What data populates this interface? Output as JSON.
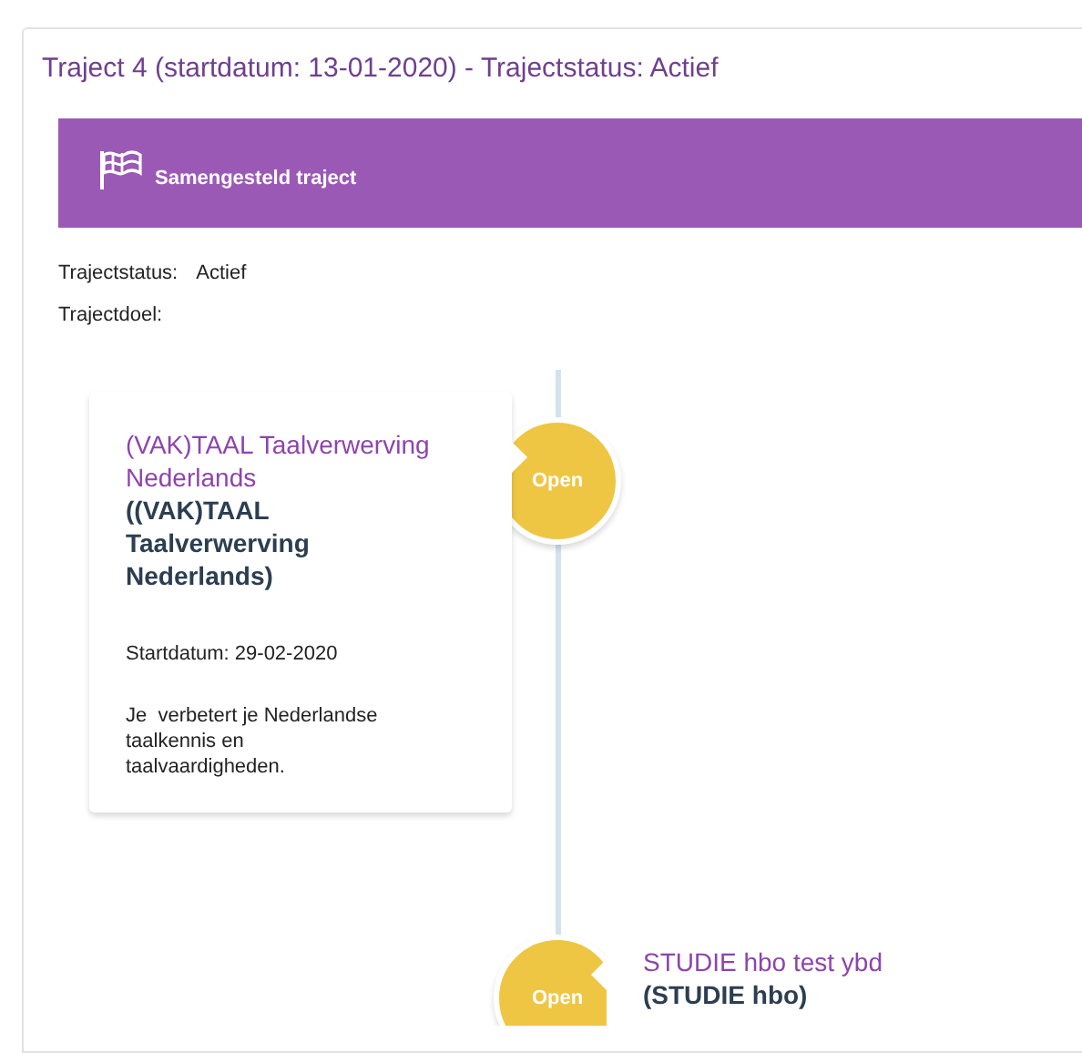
{
  "panel_title": "Traject 4 (startdatum: 13-01-2020) - Trajectstatus: Actief",
  "banner": {
    "title": "Samengesteld traject"
  },
  "details": [
    {
      "label": "Trajectstatus:",
      "value": "Actief"
    },
    {
      "label": "Trajectdoel:"
    }
  ],
  "timeline": [
    {
      "kind": "left",
      "title": "(VAK)TAAL Taalverwerving Nederlands",
      "subtitle": "((VAK)TAAL Taalverwerving Nederlands)",
      "start": "Startdatum: 29-02-2020",
      "description": "Je  verbetert je Nederlandse taalkennis en taalvaardigheden.",
      "status": "Open"
    },
    {
      "kind": "right",
      "title": "STUDIE hbo test ybd",
      "subtitle": "(STUDIE hbo)",
      "status": "Open"
    }
  ]
}
